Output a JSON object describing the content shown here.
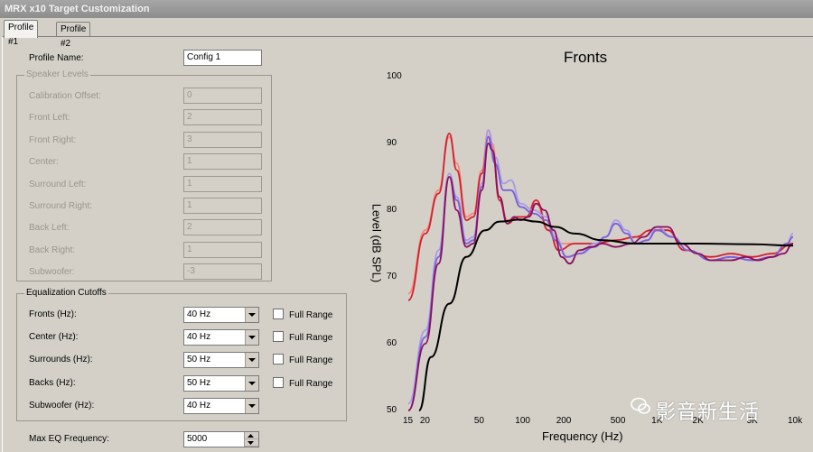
{
  "window": {
    "title": "MRX x10 Target Customization"
  },
  "tabs": [
    {
      "label": "Profile #1"
    },
    {
      "label": "Profile #2"
    }
  ],
  "profile": {
    "name_label": "Profile Name:",
    "name_value": "Config 1"
  },
  "speaker_levels": {
    "title": "Speaker Levels",
    "rows": [
      {
        "label": "Calibration Offset:",
        "value": "0"
      },
      {
        "label": "Front Left:",
        "value": "2"
      },
      {
        "label": "Front Right:",
        "value": "3"
      },
      {
        "label": "Center:",
        "value": "1"
      },
      {
        "label": "Surround Left:",
        "value": "1"
      },
      {
        "label": "Surround Right:",
        "value": "1"
      },
      {
        "label": "Back Left:",
        "value": "2"
      },
      {
        "label": "Back Right:",
        "value": "1"
      },
      {
        "label": "Subwoofer:",
        "value": "-3"
      }
    ]
  },
  "eq_cutoffs": {
    "title": "Equalization Cutoffs",
    "full_range_label": "Full Range",
    "rows": [
      {
        "label": "Fronts (Hz):",
        "value": "40 Hz",
        "full_range": false
      },
      {
        "label": "Center (Hz):",
        "value": "40 Hz",
        "full_range": false
      },
      {
        "label": "Surrounds (Hz):",
        "value": "50 Hz",
        "full_range": false
      },
      {
        "label": "Backs (Hz):",
        "value": "50 Hz",
        "full_range": false
      },
      {
        "label": "Subwoofer (Hz):",
        "value": "40 Hz"
      }
    ]
  },
  "max_eq": {
    "label": "Max EQ Frequency:",
    "value": "5000"
  },
  "watermark": {
    "text": "影音新生活",
    "icon": "wechat-icon"
  },
  "chart_data": {
    "type": "line",
    "title": "Fronts",
    "xlabel": "Frequency (Hz)",
    "ylabel": "Level (dB SPL)",
    "x_scale": "log",
    "xlim": [
      15,
      10000
    ],
    "ylim": [
      50,
      100
    ],
    "grid": false,
    "x_ticks": [
      {
        "v": 15,
        "label": "15"
      },
      {
        "v": 20,
        "label": "20"
      },
      {
        "v": 50,
        "label": "50"
      },
      {
        "v": 100,
        "label": "100"
      },
      {
        "v": 200,
        "label": "200"
      },
      {
        "v": 500,
        "label": "500"
      },
      {
        "v": 1000,
        "label": "1K"
      },
      {
        "v": 2000,
        "label": "2K"
      },
      {
        "v": 5000,
        "label": "5K"
      },
      {
        "v": 10000,
        "label": "10k"
      }
    ],
    "y_ticks": [
      50,
      60,
      70,
      80,
      90,
      100
    ],
    "series": [
      {
        "color": "#f08a7a",
        "points": [
          [
            15,
            67.5
          ],
          [
            20,
            77
          ],
          [
            25,
            83
          ],
          [
            30,
            91
          ],
          [
            34,
            87
          ],
          [
            40,
            79
          ],
          [
            45,
            79.5
          ],
          [
            52,
            86
          ],
          [
            58,
            92
          ],
          [
            62,
            90
          ],
          [
            70,
            82
          ],
          [
            80,
            78.5
          ],
          [
            95,
            79
          ],
          [
            110,
            79
          ],
          [
            130,
            81
          ],
          [
            160,
            77
          ],
          [
            190,
            75
          ],
          [
            250,
            75
          ],
          [
            350,
            75
          ],
          [
            500,
            75.5
          ],
          [
            700,
            76
          ],
          [
            900,
            77
          ],
          [
            1200,
            77
          ],
          [
            1600,
            74
          ],
          [
            2500,
            73
          ],
          [
            3500,
            73.5
          ],
          [
            5000,
            73
          ],
          [
            7000,
            73.5
          ],
          [
            10000,
            75
          ]
        ]
      },
      {
        "color": "#d42030",
        "points": [
          [
            15,
            66.5
          ],
          [
            20,
            76.5
          ],
          [
            25,
            82.5
          ],
          [
            30,
            91.5
          ],
          [
            34,
            86
          ],
          [
            40,
            78.5
          ],
          [
            45,
            79
          ],
          [
            52,
            85.5
          ],
          [
            58,
            91
          ],
          [
            62,
            89
          ],
          [
            70,
            81.5
          ],
          [
            80,
            78
          ],
          [
            95,
            79
          ],
          [
            110,
            79
          ],
          [
            130,
            81.5
          ],
          [
            160,
            77
          ],
          [
            190,
            74
          ],
          [
            250,
            75
          ],
          [
            350,
            75
          ],
          [
            500,
            75.5
          ],
          [
            700,
            76
          ],
          [
            900,
            77
          ],
          [
            1200,
            77
          ],
          [
            1600,
            74
          ],
          [
            2500,
            73
          ],
          [
            3500,
            73.5
          ],
          [
            5000,
            73
          ],
          [
            7000,
            73.5
          ],
          [
            10000,
            75
          ]
        ]
      },
      {
        "color": "#a99ae8",
        "points": [
          [
            15,
            51
          ],
          [
            20,
            62
          ],
          [
            25,
            74
          ],
          [
            30,
            85.5
          ],
          [
            34,
            82
          ],
          [
            40,
            75.5
          ],
          [
            45,
            76
          ],
          [
            52,
            84
          ],
          [
            58,
            92
          ],
          [
            65,
            88
          ],
          [
            75,
            84
          ],
          [
            85,
            84.5
          ],
          [
            100,
            81
          ],
          [
            125,
            80
          ],
          [
            155,
            79
          ],
          [
            180,
            76
          ],
          [
            220,
            73
          ],
          [
            270,
            73.5
          ],
          [
            350,
            75
          ],
          [
            420,
            76
          ],
          [
            500,
            78.5
          ],
          [
            600,
            77
          ],
          [
            700,
            75
          ],
          [
            850,
            75.5
          ],
          [
            1000,
            77.5
          ],
          [
            1300,
            76
          ],
          [
            1700,
            74
          ],
          [
            2500,
            72.5
          ],
          [
            3500,
            73
          ],
          [
            5000,
            72.5
          ],
          [
            7000,
            73
          ],
          [
            9000,
            75
          ],
          [
            10000,
            76.5
          ]
        ]
      },
      {
        "color": "#7a60d8",
        "points": [
          [
            15,
            50
          ],
          [
            20,
            61
          ],
          [
            25,
            73
          ],
          [
            30,
            85
          ],
          [
            34,
            81.5
          ],
          [
            40,
            75
          ],
          [
            45,
            75.5
          ],
          [
            52,
            83.5
          ],
          [
            58,
            91
          ],
          [
            65,
            87
          ],
          [
            75,
            83
          ],
          [
            85,
            83
          ],
          [
            100,
            80.5
          ],
          [
            125,
            79.5
          ],
          [
            155,
            78.5
          ],
          [
            180,
            75.5
          ],
          [
            220,
            73
          ],
          [
            270,
            73.5
          ],
          [
            350,
            74.5
          ],
          [
            420,
            76
          ],
          [
            500,
            78
          ],
          [
            600,
            76.5
          ],
          [
            700,
            75
          ],
          [
            850,
            75.5
          ],
          [
            1000,
            77
          ],
          [
            1300,
            76
          ],
          [
            1700,
            74
          ],
          [
            2500,
            72.5
          ],
          [
            3500,
            73
          ],
          [
            5000,
            72.5
          ],
          [
            7000,
            73
          ],
          [
            9000,
            75
          ],
          [
            10000,
            76
          ]
        ]
      },
      {
        "color": "#8a1060",
        "points": [
          [
            15,
            50
          ],
          [
            20,
            60
          ],
          [
            25,
            72
          ],
          [
            30,
            85
          ],
          [
            34,
            80
          ],
          [
            40,
            74.5
          ],
          [
            45,
            75
          ],
          [
            52,
            83
          ],
          [
            58,
            90
          ],
          [
            62,
            89
          ],
          [
            70,
            82
          ],
          [
            80,
            78
          ],
          [
            90,
            79
          ],
          [
            100,
            78.5
          ],
          [
            115,
            79
          ],
          [
            130,
            81
          ],
          [
            150,
            80
          ],
          [
            175,
            77
          ],
          [
            200,
            73
          ],
          [
            230,
            72
          ],
          [
            270,
            74
          ],
          [
            330,
            74.5
          ],
          [
            400,
            75
          ],
          [
            500,
            74.5
          ],
          [
            650,
            75
          ],
          [
            800,
            76
          ],
          [
            1000,
            77.5
          ],
          [
            1200,
            77.5
          ],
          [
            1500,
            75
          ],
          [
            2000,
            73.5
          ],
          [
            2500,
            72.5
          ],
          [
            3500,
            72.5
          ],
          [
            4500,
            73
          ],
          [
            5500,
            72.5
          ],
          [
            7000,
            73
          ],
          [
            8500,
            73.5
          ],
          [
            10000,
            75
          ]
        ]
      },
      {
        "color": "#000000",
        "points": [
          [
            18,
            50
          ],
          [
            22,
            58
          ],
          [
            30,
            66
          ],
          [
            40,
            73
          ],
          [
            55,
            77
          ],
          [
            70,
            78.3
          ],
          [
            100,
            78.6
          ],
          [
            130,
            78.3
          ],
          [
            180,
            77.5
          ],
          [
            250,
            76.5
          ],
          [
            400,
            75.5
          ],
          [
            700,
            75
          ],
          [
            1000,
            75
          ],
          [
            2000,
            75
          ],
          [
            5000,
            74.9
          ],
          [
            10000,
            74.7
          ]
        ]
      }
    ]
  }
}
